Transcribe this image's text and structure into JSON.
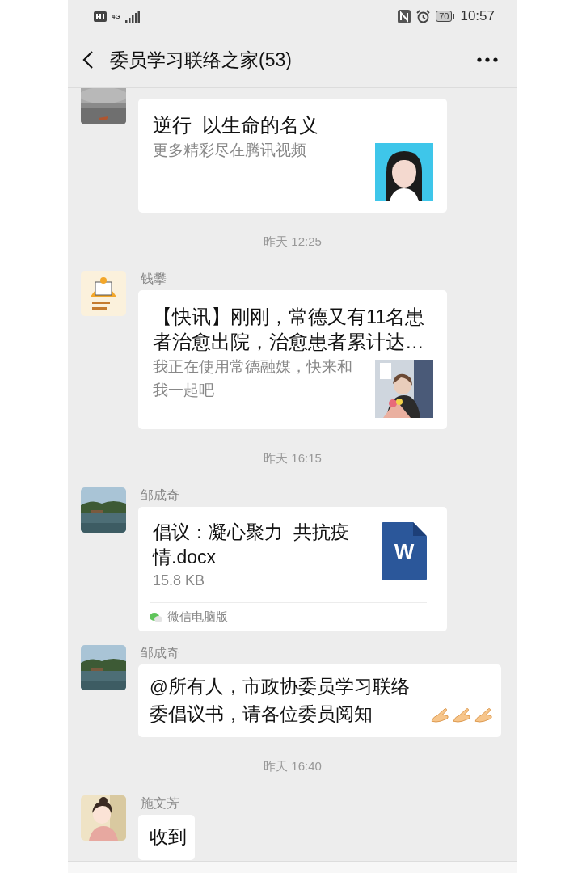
{
  "status_bar": {
    "network": "4G",
    "battery": "70",
    "time": "10:57"
  },
  "header": {
    "title": "委员学习联络之家(53)"
  },
  "chat": [
    {
      "kind": "link",
      "title": "逆行  以生命的名义",
      "description": "更多精彩尽在腾讯视频"
    },
    {
      "kind": "time",
      "text": "昨天 12:25"
    },
    {
      "kind": "link",
      "sender": "钱攀",
      "title": "【快讯】刚刚，常德又有11名患者治愈出院，治愈患者累计达…",
      "description": "我正在使用常德融媒，快来和我一起吧"
    },
    {
      "kind": "time",
      "text": "昨天 16:15"
    },
    {
      "kind": "file",
      "sender": "邹成奇",
      "file_name": "倡议：凝心聚力  共抗疫情.docx",
      "file_size": "15.8 KB",
      "file_type": "W",
      "source": "微信电脑版"
    },
    {
      "kind": "text",
      "sender": "邹成奇",
      "text": "@所有人，市政协委员学习联络委倡议书，请各位委员阅知",
      "emoji": [
        {
          "kind": "hand"
        },
        {
          "kind": "hand"
        },
        {
          "kind": "hand"
        }
      ]
    },
    {
      "kind": "time",
      "text": "昨天 16:40"
    },
    {
      "kind": "text",
      "sender": "施文芳",
      "text": "收到"
    }
  ]
}
